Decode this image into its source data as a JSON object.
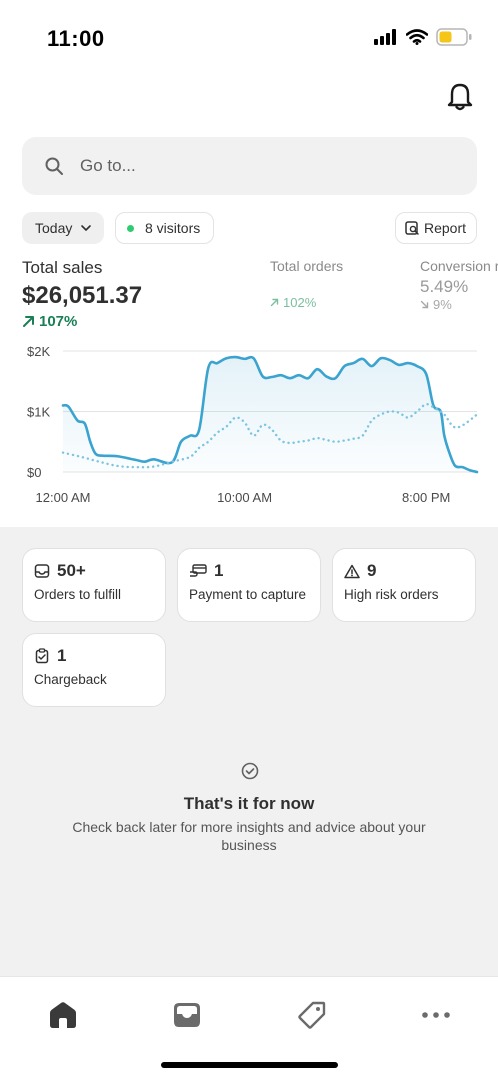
{
  "status_bar": {
    "time": "11:00"
  },
  "search": {
    "placeholder": "Go to..."
  },
  "filters": {
    "period": "Today",
    "visitors": "8 visitors",
    "report": "Report"
  },
  "metrics": {
    "total_sales": {
      "label": "Total sales",
      "value": "$26,051.37",
      "delta": "107%"
    },
    "total_orders": {
      "label": "Total orders",
      "delta": "102%"
    },
    "conversion": {
      "label": "Conversion rate",
      "value": "5.49%",
      "delta": "9%"
    }
  },
  "chart_data": {
    "type": "line",
    "ylim": [
      0,
      2000
    ],
    "y_ticks": [
      "$0",
      "$1K",
      "$2K"
    ],
    "x_ticks": [
      {
        "hour": 0,
        "label": "12:00 AM"
      },
      {
        "hour": 10,
        "label": "10:00 AM"
      },
      {
        "hour": 20,
        "label": "8:00 PM"
      }
    ],
    "xlim": [
      0,
      22.8
    ],
    "series": [
      {
        "style": "solid",
        "color": "#3aa3cf",
        "x": [
          0,
          0.3,
          0.8,
          1.2,
          1.5,
          1.8,
          2.2,
          3,
          4,
          4.5,
          5,
          6,
          6.5,
          7,
          7.5,
          8,
          8.5,
          9,
          9.5,
          10,
          10.5,
          11,
          11.5,
          12,
          12.5,
          13,
          13.5,
          14,
          14.5,
          15,
          15.5,
          16,
          16.5,
          17,
          17.5,
          18,
          18.5,
          19,
          19.5,
          20,
          20.4,
          20.8,
          21,
          21.3,
          21.6,
          22,
          22.4,
          22.8
        ],
        "y": [
          1100,
          1080,
          850,
          800,
          500,
          300,
          270,
          260,
          200,
          170,
          210,
          160,
          500,
          600,
          700,
          1720,
          1800,
          1880,
          1900,
          1870,
          1880,
          1580,
          1570,
          1600,
          1550,
          1600,
          1550,
          1700,
          1580,
          1550,
          1750,
          1800,
          1870,
          1750,
          1880,
          1850,
          1770,
          1800,
          1750,
          1620,
          1100,
          1000,
          600,
          300,
          100,
          80,
          30,
          0
        ]
      },
      {
        "style": "dotted",
        "color": "#7cc4e0",
        "x": [
          0,
          1,
          2,
          3,
          4,
          5,
          6,
          7,
          7.5,
          8,
          8.5,
          9,
          9.5,
          10,
          10.5,
          11,
          11.5,
          12,
          12.5,
          13,
          13.5,
          14,
          14.5,
          15,
          15.5,
          16,
          16.5,
          17,
          17.5,
          18,
          18.5,
          19,
          19.5,
          20,
          20.5,
          21,
          21.5,
          22,
          22.8
        ],
        "y": [
          320,
          250,
          170,
          100,
          80,
          90,
          170,
          250,
          400,
          500,
          650,
          750,
          900,
          820,
          600,
          780,
          700,
          520,
          480,
          500,
          520,
          560,
          530,
          500,
          520,
          550,
          600,
          850,
          950,
          1000,
          980,
          900,
          1000,
          1120,
          1050,
          950,
          750,
          770,
          950
        ]
      }
    ]
  },
  "cards": [
    {
      "icon": "inbox-icon",
      "count": "50+",
      "label": "Orders to fulfill"
    },
    {
      "icon": "payment-icon",
      "count": "1",
      "label": "Payment to capture"
    },
    {
      "icon": "warning-icon",
      "count": "9",
      "label": "High risk orders"
    },
    {
      "icon": "chargeback-icon",
      "count": "1",
      "label": "Chargeback"
    }
  ],
  "empty_state": {
    "icon": "check-circle-icon",
    "title": "That's it for now",
    "text": "Check back later for more insights and advice about your business"
  },
  "tabs": [
    {
      "name": "home",
      "icon": "home-icon",
      "active": true
    },
    {
      "name": "orders",
      "icon": "inbox-icon"
    },
    {
      "name": "products",
      "icon": "tag-icon"
    },
    {
      "name": "more",
      "icon": "more-icon"
    }
  ],
  "colors": {
    "accent": "#3aa3cf",
    "positive": "#1a7f56",
    "text": "#303030",
    "surface": "#f1f1f1"
  }
}
